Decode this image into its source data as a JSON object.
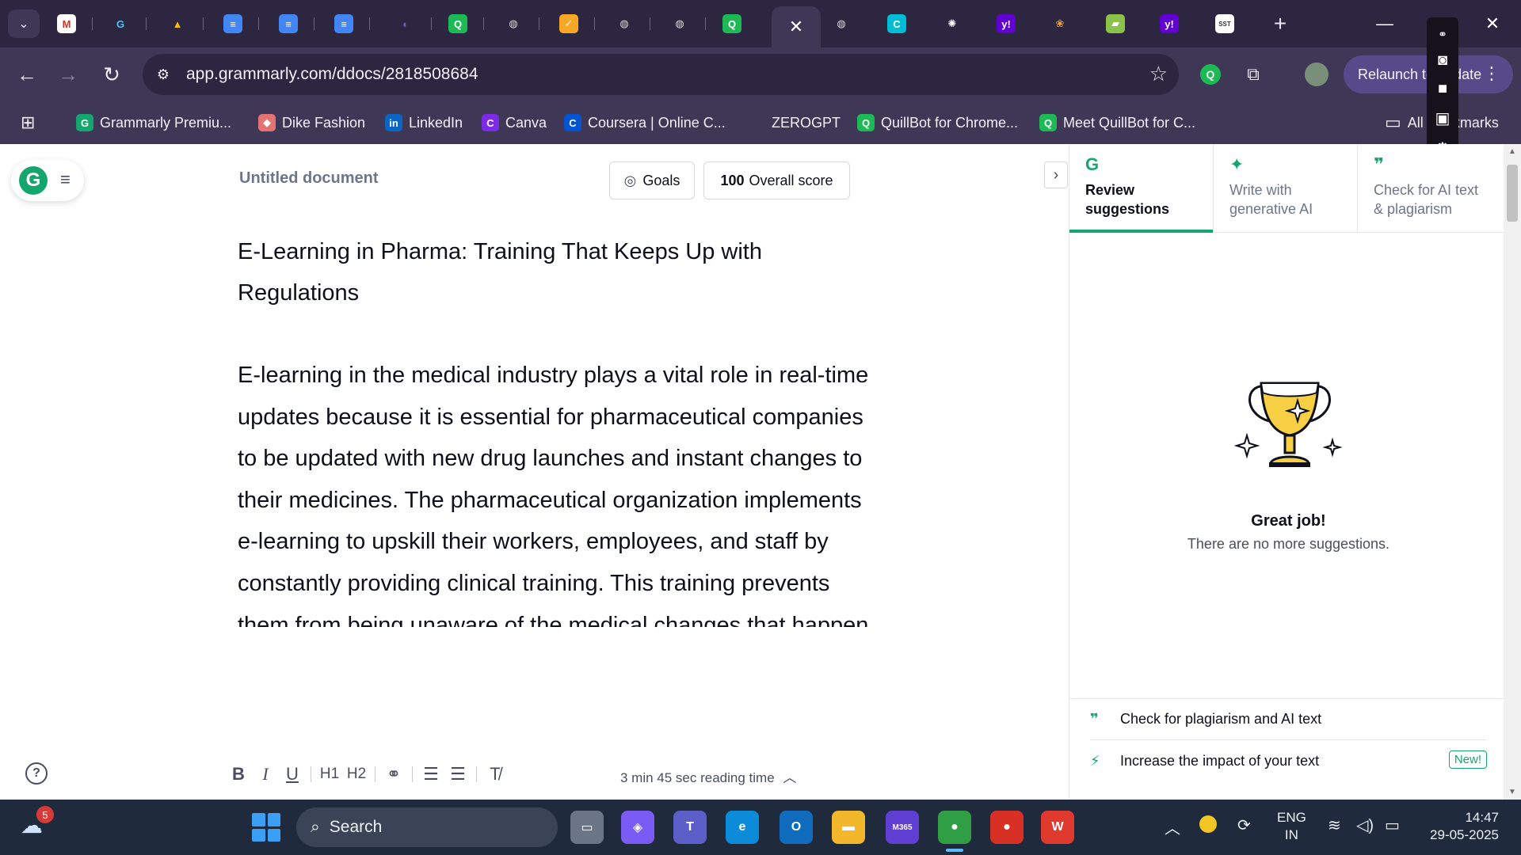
{
  "browser": {
    "tabs": [
      {
        "icon": "gmail-icon",
        "glyph": "M",
        "color": "#ffffff",
        "text_color": "#d93025"
      },
      {
        "icon": "google-icon",
        "glyph": "G",
        "color": "#2d2640",
        "text_color": "#4fc3f7"
      },
      {
        "icon": "drive-icon",
        "glyph": "▲",
        "color": "#2d2640",
        "text_color": "#fbbc04"
      },
      {
        "icon": "docs-icon",
        "glyph": "≡",
        "color": "#4285f4",
        "text_color": "#ffffff"
      },
      {
        "icon": "docs-icon",
        "glyph": "≡",
        "color": "#4285f4",
        "text_color": "#ffffff"
      },
      {
        "icon": "docs-icon",
        "glyph": "≡",
        "color": "#4285f4",
        "text_color": "#ffffff"
      },
      {
        "icon": "half-moon-icon",
        "glyph": "◐",
        "color": "#2d2640",
        "text_color": "#5c6bc0"
      },
      {
        "icon": "quillbot-icon",
        "glyph": "Q",
        "color": "#1db954",
        "text_color": "#ffffff"
      },
      {
        "icon": "globe-icon",
        "glyph": "◍",
        "color": "#2d2640",
        "text_color": "#dcdcdc"
      },
      {
        "icon": "check-icon",
        "glyph": "✓",
        "color": "#f9a825",
        "text_color": "#ffffff"
      },
      {
        "icon": "globe-icon",
        "glyph": "◍",
        "color": "#2d2640",
        "text_color": "#dcdcdc"
      },
      {
        "icon": "globe-icon",
        "glyph": "◍",
        "color": "#2d2640",
        "text_color": "#dcdcdc"
      },
      {
        "icon": "quillbot-icon",
        "glyph": "Q",
        "color": "#1db954",
        "text_color": "#ffffff"
      }
    ],
    "active_tab_close": "✕",
    "tabs_right": [
      {
        "icon": "globe-icon",
        "glyph": "◍",
        "color": "#2d2640",
        "text_color": "#dcdcdc"
      },
      {
        "icon": "edge-c-icon",
        "glyph": "C",
        "color": "#00bcd4",
        "text_color": "#ffffff"
      },
      {
        "icon": "openai-icon",
        "glyph": "✺",
        "color": "#2d2640",
        "text_color": "#ffffff"
      },
      {
        "icon": "yahoo-icon",
        "glyph": "y!",
        "color": "#6001d2",
        "text_color": "#ffffff"
      },
      {
        "icon": "claude-icon",
        "glyph": "❀",
        "color": "#2d2640",
        "text_color": "#f0a030"
      },
      {
        "icon": "note-icon",
        "glyph": "▰",
        "color": "#8bc34a",
        "text_color": "#ffffff"
      },
      {
        "icon": "yahoo-icon",
        "glyph": "y!",
        "color": "#6001d2",
        "text_color": "#ffffff"
      },
      {
        "icon": "sst-icon",
        "glyph": "SST",
        "color": "#ffffff",
        "text_color": "#333333"
      }
    ],
    "url": "app.grammarly.com/ddocs/2818508684",
    "relaunch_label": "Relaunch to update",
    "bookmarks": [
      {
        "icon": "grammarly-icon",
        "glyph": "G",
        "color": "#15a66d",
        "label": "Grammarly Premiu..."
      },
      {
        "icon": "dike-fashion-icon",
        "glyph": "◆",
        "color": "#e57373",
        "label": "Dike Fashion"
      },
      {
        "icon": "linkedin-icon",
        "glyph": "in",
        "color": "#0a66c2",
        "label": "LinkedIn"
      },
      {
        "icon": "canva-icon",
        "glyph": "C",
        "color": "#7d2ae8",
        "label": "Canva"
      },
      {
        "icon": "coursera-icon",
        "glyph": "C",
        "color": "#0056d2",
        "label": "Coursera | Online C..."
      },
      {
        "icon": "zerogpt-icon",
        "glyph": "",
        "color": "#3f3756",
        "label": "ZEROGPT"
      },
      {
        "icon": "quillbot-icon",
        "glyph": "Q",
        "color": "#1db954",
        "label": "QuillBot for Chrome..."
      },
      {
        "icon": "quillbot-icon",
        "glyph": "Q",
        "color": "#1db954",
        "label": "Meet QuillBot for C..."
      }
    ],
    "all_bookmarks": "All Bookmarks"
  },
  "grammarly": {
    "doc_title": "Untitled document",
    "goals_label": "Goals",
    "score_value": "100",
    "score_label": "Overall score",
    "heading": "E-Learning in Pharma: Training That Keeps Up with Regulations",
    "body": "E-learning in the medical industry plays a vital role in real-time updates because it is essential for pharmaceutical companies to be updated with new drug launches and instant changes to their medicines. The pharmaceutical organization implements e-learning to upskill their workers, employees, and staff by constantly providing clinical training. This training prevents them from being unaware of the medical changes that happen daily. To learn more about productive e-learning training",
    "reading_time": "3 min 45 sec reading time",
    "panel": {
      "tabs": [
        {
          "label": "Review suggestions",
          "icon": "G"
        },
        {
          "label": "Write with generative AI",
          "icon": "✦"
        },
        {
          "label": "Check for AI text & plagiarism",
          "icon": "❞"
        }
      ],
      "great_job": "Great job!",
      "no_more": "There are no more suggestions.",
      "footer": [
        {
          "icon": "❞",
          "label": "Check for plagiarism and AI text"
        },
        {
          "icon": "⚡",
          "label": "Increase the impact of your text",
          "badge": "New!"
        }
      ]
    }
  },
  "taskbar": {
    "weather_badge": "5",
    "search_label": "Search",
    "apps": [
      {
        "icon": "task-view-icon",
        "glyph": "▭",
        "color": "#6b7587"
      },
      {
        "icon": "copilot-icon",
        "glyph": "◈",
        "color": "#7a5cf5"
      },
      {
        "icon": "teams-icon",
        "glyph": "T",
        "color": "#5b5fc7"
      },
      {
        "icon": "edge-icon",
        "glyph": "e",
        "color": "#0b8bd8"
      },
      {
        "icon": "outlook-icon",
        "glyph": "O",
        "color": "#0f6cbd"
      },
      {
        "icon": "file-explorer-icon",
        "glyph": "▬",
        "color": "#f3b72b"
      },
      {
        "icon": "m365-icon",
        "glyph": "M365",
        "color": "#5e3fd1"
      },
      {
        "icon": "chrome-icon",
        "glyph": "●",
        "color": "#2f9e44"
      },
      {
        "icon": "chrome-icon",
        "glyph": "●",
        "color": "#d93025"
      },
      {
        "icon": "wps-icon",
        "glyph": "W",
        "color": "#e03a2f"
      }
    ],
    "language": "ENG",
    "region": "IN",
    "time": "14:47",
    "date": "29-05-2025"
  }
}
